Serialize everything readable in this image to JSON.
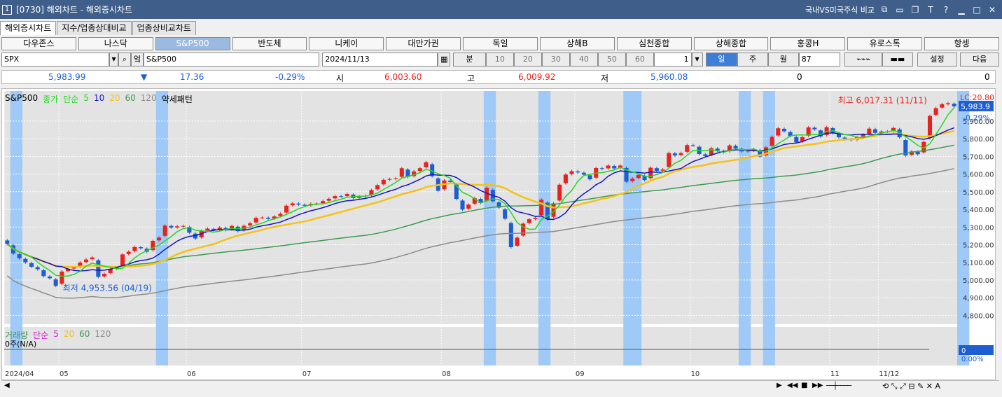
{
  "window": {
    "title": "[0730] 해외차트 - 해외증시차트",
    "compare_label": "국내VS미국주식 비교",
    "icon_label": "1"
  },
  "tabs": [
    {
      "label": "해외증시차트",
      "active": true
    },
    {
      "label": "지수/업종상대비교",
      "active": false
    },
    {
      "label": "업종상비교차트",
      "active": false
    }
  ],
  "markets": [
    {
      "label": "다우존스",
      "active": false
    },
    {
      "label": "나스닥",
      "active": false
    },
    {
      "label": "S&P500",
      "active": true
    },
    {
      "label": "반도체",
      "active": false
    },
    {
      "label": "니케이",
      "active": false
    },
    {
      "label": "대만가권",
      "active": false
    },
    {
      "label": "독일",
      "active": false
    },
    {
      "label": "상해B",
      "active": false
    },
    {
      "label": "심천종합",
      "active": false
    },
    {
      "label": "상해종합",
      "active": false
    },
    {
      "label": "홍콩H",
      "active": false
    },
    {
      "label": "유로스톡",
      "active": false
    },
    {
      "label": "항셍",
      "active": false
    }
  ],
  "controls": {
    "symbol": "SPX",
    "name": "S&P500",
    "date": "2024/11/13",
    "minute_label": "분",
    "minute_intervals": [
      "10",
      "20",
      "30",
      "40",
      "50",
      "60"
    ],
    "interval_value": "1",
    "period_day": "일",
    "period_week": "주",
    "period_month": "월",
    "count": "87",
    "settings_label": "설정",
    "next_label": "다음",
    "jump_label": "엌"
  },
  "quote": {
    "price": "5,983.99",
    "change_arrow": "▼",
    "change": "17.36",
    "change_pct": "-0.29%",
    "open_label": "시",
    "open": "6,003.60",
    "high_label": "고",
    "high": "6,009.92",
    "low_label": "저",
    "low": "5,960.08",
    "volume": "0",
    "volume2": "0"
  },
  "legend": {
    "symbol": "S&P500",
    "basis": "종가",
    "ma_type": "단순",
    "periods": [
      "5",
      "10",
      "20",
      "60",
      "120"
    ],
    "pattern": "약세패턴"
  },
  "volume_legend": {
    "label": "거래량",
    "ma_type": "단순",
    "periods": [
      "5",
      "20",
      "60",
      "120"
    ],
    "value_text": "0주(N/A)",
    "axis_value": "0",
    "axis_pct": "0.00%"
  },
  "annotations": {
    "high": "최고 6,017.31 (11/11)",
    "low": "최저 4,953.56 (04/19)",
    "lc": "LC:20.80",
    "last_price": "5,983.9",
    "last_pct": "-0.29%"
  },
  "colors": {
    "up": "#e8231e",
    "down": "#1d5fd3",
    "ma5": "#21d921",
    "ma10": "#1414c8",
    "ma20": "#f5c218",
    "ma60": "#3c9c50",
    "ma120": "#8c8c8c",
    "highlight": "#9fcaf7"
  },
  "chart_data": {
    "type": "candlestick",
    "ylim": [
      4750,
      6070
    ],
    "y_ticks": [
      4800,
      4900,
      5000,
      5100,
      5200,
      5300,
      5400,
      5500,
      5600,
      5700,
      5800,
      5900
    ],
    "x_labels": [
      {
        "label": "2024/04",
        "index": 0
      },
      {
        "label": "05",
        "index": 9
      },
      {
        "label": "06",
        "index": 30
      },
      {
        "label": "07",
        "index": 49
      },
      {
        "label": "08",
        "index": 72
      },
      {
        "label": "09",
        "index": 94
      },
      {
        "label": "10",
        "index": 113
      },
      {
        "label": "11",
        "index": 136
      },
      {
        "label": "11/12",
        "index": 144
      }
    ],
    "closes": [
      5204,
      5150,
      5123,
      5100,
      5075,
      5061,
      5022,
      5010,
      4967,
      5048,
      5064,
      5071,
      5099,
      5116,
      5128,
      5018,
      5035,
      5064,
      5071,
      5145,
      5160,
      5187,
      5180,
      5160,
      5222,
      5240,
      5308,
      5297,
      5304,
      5306,
      5268,
      5235,
      5278,
      5291,
      5283,
      5297,
      5283,
      5306,
      5277,
      5307,
      5321,
      5352,
      5354,
      5346,
      5360,
      5375,
      5421,
      5434,
      5427,
      5421,
      5431,
      5433,
      5447,
      5460,
      5475,
      5473,
      5487,
      5464,
      5473,
      5477,
      5509,
      5537,
      5567,
      5572,
      5576,
      5633,
      5584,
      5615,
      5633,
      5667,
      5588,
      5505,
      5564,
      5555,
      5459,
      5399,
      5427,
      5463,
      5436,
      5522,
      5446,
      5410,
      5347,
      5186,
      5240,
      5319,
      5344,
      5352,
      5455,
      5344,
      5434,
      5540,
      5597,
      5616,
      5609,
      5597,
      5570,
      5634,
      5629,
      5648,
      5632,
      5648,
      5557,
      5574,
      5595,
      5566,
      5636,
      5618,
      5626,
      5719,
      5705,
      5719,
      5764,
      5762,
      5713,
      5702,
      5746,
      5732,
      5723,
      5762,
      5745,
      5728,
      5732,
      5741,
      5699,
      5751,
      5811,
      5859,
      5842,
      5815,
      5780,
      5809,
      5864,
      5853,
      5813,
      5865,
      5832,
      5808,
      5797,
      5792,
      5809,
      5823,
      5857,
      5833,
      5841,
      5841,
      5861,
      5808,
      5705,
      5728,
      5712,
      5782,
      5929,
      5973,
      5995,
      6001,
      5983
    ],
    "high": {
      "value": 6017.31,
      "date": "11/11"
    },
    "low": {
      "value": 4953.56,
      "date": "04/19"
    },
    "highlight_ranges": [
      [
        1,
        2
      ],
      [
        25,
        26
      ],
      [
        79,
        80
      ],
      [
        88,
        89
      ],
      [
        102,
        104
      ],
      [
        121,
        122
      ],
      [
        125,
        126
      ],
      [
        157,
        158
      ]
    ]
  }
}
